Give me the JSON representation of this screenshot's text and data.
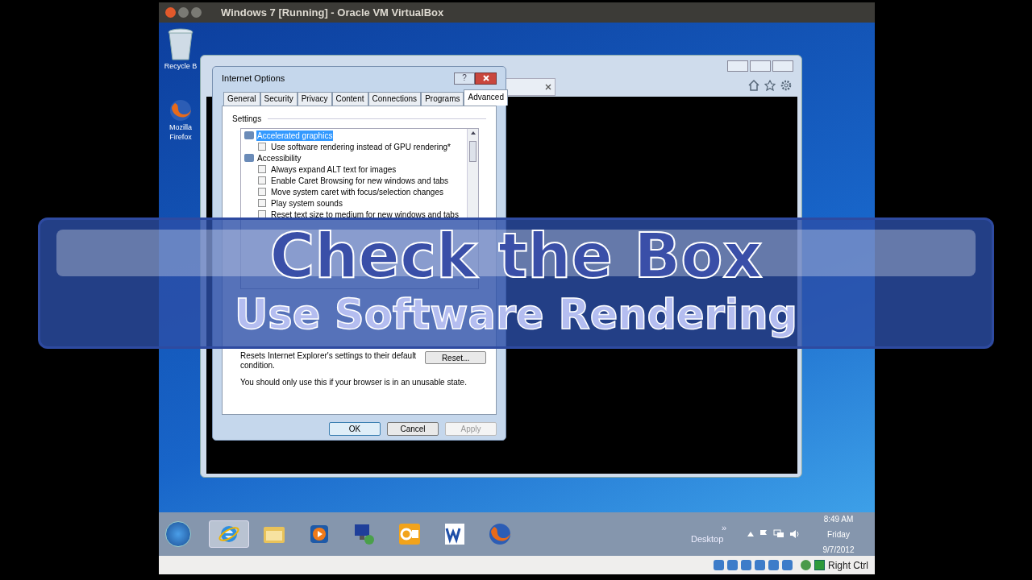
{
  "vbox_window": {
    "title": "Windows 7 [Running] - Oracle VM VirtualBox"
  },
  "desktop_icons": [
    {
      "label": "Recycle B",
      "kind": "bin"
    },
    {
      "label": "Mozilla Firefox",
      "kind": "firefox"
    }
  ],
  "dialog": {
    "title": "Internet Options",
    "help": "?",
    "tabs": [
      {
        "label": "General",
        "selected": false
      },
      {
        "label": "Security",
        "selected": false
      },
      {
        "label": "Privacy",
        "selected": false
      },
      {
        "label": "Content",
        "selected": false
      },
      {
        "label": "Connections",
        "selected": false
      },
      {
        "label": "Programs",
        "selected": false
      },
      {
        "label": "Advanced",
        "selected": true
      }
    ],
    "settings_label": "Settings",
    "settings": [
      {
        "kind": "group",
        "label": "Accelerated graphics",
        "selected": true
      },
      {
        "kind": "option",
        "label": "Use software rendering instead of GPU rendering*",
        "checked": false
      },
      {
        "kind": "group",
        "label": "Accessibility",
        "selected": false
      },
      {
        "kind": "option",
        "label": "Always expand ALT text for images",
        "checked": false
      },
      {
        "kind": "option",
        "label": "Enable Caret Browsing for new windows and tabs",
        "checked": false
      },
      {
        "kind": "option",
        "label": "Move system caret with focus/selection changes",
        "checked": false
      },
      {
        "kind": "option",
        "label": "Play system sounds",
        "checked": false
      },
      {
        "kind": "option",
        "label": "Reset text size to medium for new windows and tabs",
        "checked": false
      }
    ],
    "reset_text": "Resets Internet Explorer's settings to their default condition.",
    "reset_button": "Reset...",
    "warning": "You should only use this if your browser is in an unusable state.",
    "buttons": [
      {
        "label": "OK",
        "disabled": false
      },
      {
        "label": "Cancel",
        "disabled": false
      },
      {
        "label": "Apply",
        "disabled": true
      }
    ]
  },
  "banner": {
    "title": "Check the Box",
    "subtitle": "Use Software Rendering"
  },
  "taskbar": {
    "apps": [
      {
        "kind": "ie",
        "selected": true
      },
      {
        "kind": "folder",
        "selected": false
      },
      {
        "kind": "media",
        "selected": false
      },
      {
        "kind": "network",
        "selected": false
      },
      {
        "kind": "outlook",
        "selected": false
      },
      {
        "kind": "word",
        "selected": false
      },
      {
        "kind": "firefox",
        "selected": false
      }
    ],
    "chevron": "»",
    "toolbar_label": "Desktop",
    "time": "8:49 AM",
    "day": "Friday",
    "date": "9/7/2012"
  },
  "status_bar": {
    "host_key": "Right Ctrl"
  }
}
